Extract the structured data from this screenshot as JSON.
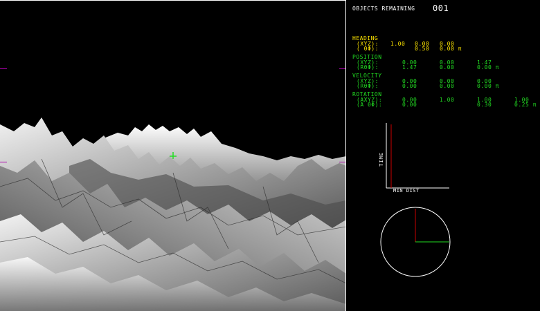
{
  "hud": {
    "objects_label": "OBJECTS REMAINING",
    "objects_value": "001",
    "heading": {
      "title": "HEADING",
      "row1_label": "(XYZ):",
      "row1_values": [
        "1.00",
        "0.00",
        "0.00"
      ],
      "row2_label": "( θΦ):",
      "row2_values": [
        "0.50",
        "0.00 π"
      ]
    },
    "position": {
      "title": "POSITION",
      "row1_label": "(XYZ):",
      "row1_values": [
        "0.00",
        "0.00",
        "1.47"
      ],
      "row2_label": "(RθΦ):",
      "row2_values": [
        "1.47",
        "0.00",
        "0.00 π"
      ]
    },
    "velocity": {
      "title": "VELOCITY",
      "row1_label": "(XYZ):",
      "row1_values": [
        "0.00",
        "0.00",
        "0.00"
      ],
      "row2_label": "(RθΦ):",
      "row2_values": [
        "0.00",
        "0.00",
        "0.00 π"
      ]
    },
    "rotation": {
      "title": "ROTATION",
      "row1_label": "(AXYZ):",
      "row1_values": [
        "0.00",
        "1.00",
        "1.00",
        "1.00"
      ],
      "row2_label": "(A θΦ):",
      "row2_values": [
        "0.00",
        "0.30",
        "0.25 π"
      ]
    },
    "graph": {
      "ylabel": "TIME",
      "xlabel": "MIN DIST"
    }
  },
  "colors": {
    "section_title": "#ffe600",
    "value_text": "#22dd22",
    "terrain_base": "#b8b8b8",
    "crosshair": "#aa00aa"
  }
}
